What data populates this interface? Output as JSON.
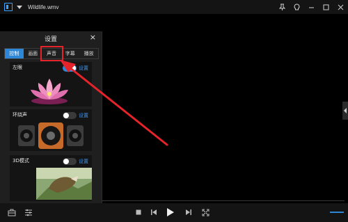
{
  "window": {
    "title": "Wildlife.wmv",
    "accent": "#2e86d6",
    "icons": [
      "app-logo-icon",
      "menu-caret-icon",
      "pin-icon",
      "skin-icon",
      "minimize-icon",
      "maximize-icon",
      "close-icon"
    ]
  },
  "settings_panel": {
    "title": "设置",
    "close_label": "×",
    "tabs": [
      {
        "label": "控制",
        "active": true
      },
      {
        "label": "画面",
        "active": false
      },
      {
        "label": "声音",
        "active": false
      },
      {
        "label": "字幕",
        "active": false
      },
      {
        "label": "播放",
        "active": false
      }
    ],
    "highlighted_tab": "声音",
    "highlight_color": "#e4232a",
    "sections": [
      {
        "label": "左眼",
        "toggle_on": true,
        "link": "设置"
      },
      {
        "label": "环绕声",
        "toggle_on": false,
        "link": "设置"
      },
      {
        "label": "3D模式",
        "toggle_on": false,
        "link": "设置"
      }
    ]
  },
  "controls": {
    "icons": [
      "toolbox-icon",
      "playlist-settings-icon",
      "stop-icon",
      "previous-icon",
      "play-icon",
      "next-icon",
      "fullscreen-icon",
      "volume-bar"
    ]
  }
}
